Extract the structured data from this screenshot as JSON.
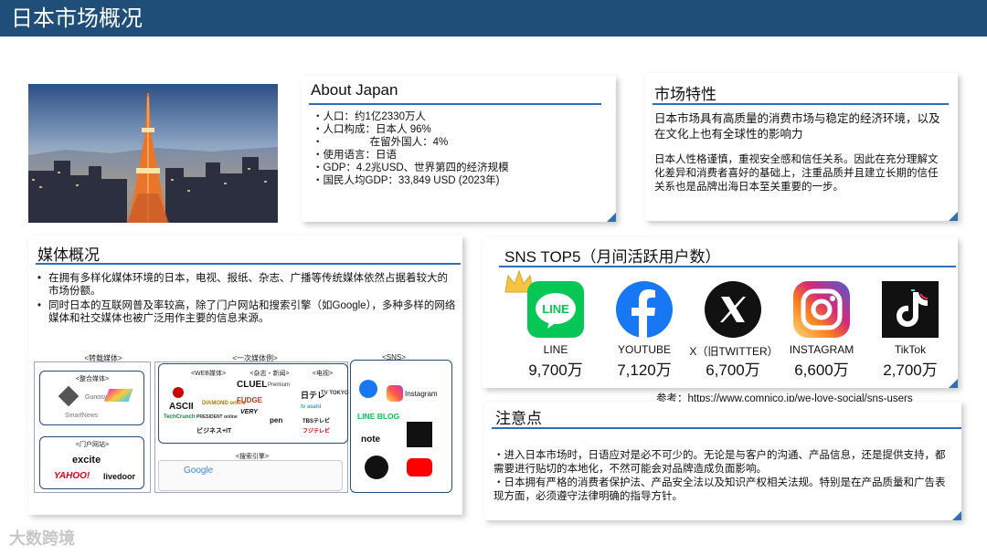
{
  "header": {
    "title": "日本市场概况"
  },
  "about": {
    "title": "About Japan",
    "items": [
      "人口：约1亿2330万人",
      "人口构成：日本人  96%",
      "                在留外国人：4%",
      "使用语言：日语",
      "GDP：4.2兆USD、世界第四的经济规模",
      "国民人均GDP：33,849 USD (2023年)"
    ]
  },
  "market": {
    "title": "市场特性",
    "p1": "日本市场具有高质量的消费市场与稳定的经济环境，以及在文化上也有全球性的影响力",
    "p2": "日本人性格谨慎，重视安全感和信任关系。因此在充分理解文化差异和消费者喜好的基础上，注重品质并且建立长期的信任关系也是品牌出海日本至关重要的一步。"
  },
  "media": {
    "title": "媒体概况",
    "bullets": [
      "在拥有多样化媒体环境的日本，电视、报纸、杂志、广播等传统媒体依然占据着较大的市场份额。",
      "同时日本的互联网普及率较高，除了门户网站和搜索引擎（如Google），多种多样的网络媒体和社交媒体也被广泛用作主要的信息来源。"
    ],
    "diagram": {
      "reprint": "<转载媒体>",
      "aggregate": "<整合媒体>",
      "portal": "<门户网站>",
      "primary": "<一次媒体例>",
      "web": "<WEB媒体>",
      "magazine": "<杂志・新闻>",
      "tv": "<电视>",
      "search": "<搜索引擎>",
      "sns": "<SNS>",
      "brands": {
        "gunosy": "Gunosy",
        "smartnews": "SmartNews",
        "excite": "excite",
        "yahoo": "YAHOO!",
        "livedoor": "livedoor",
        "clue": "CLUEL",
        "premium": "Premium",
        "ascii": "ASCII",
        "diamond": "DIAMOND online",
        "fudge": "FUDGE",
        "techcrunch": "TechCrunch",
        "president": "PRESIDENT online",
        "very": "VERY",
        "pen": "pen",
        "bizit": "ビジネス+IT",
        "ntv": "日テレ",
        "tvtokyo": "TV TOKYO",
        "tbs": "TBSテレビ",
        "fuji": "フジテレビ",
        "tvasahi": "tv asahi",
        "google": "Google",
        "instagram": "Instagram",
        "lineblog": "LINE BLOG",
        "note": "note"
      }
    }
  },
  "sns": {
    "title": "SNS TOP5（月间活跃用户数）",
    "items": [
      {
        "name": "LINE",
        "value": "9,700万"
      },
      {
        "name": "YOUTUBE",
        "value": "7,120万"
      },
      {
        "name": "X（旧TWITTER）",
        "value": "6,700万"
      },
      {
        "name": "INSTAGRAM",
        "value": "6,600万"
      },
      {
        "name": "TikTok",
        "value": "2,700万"
      }
    ],
    "ref_prefix": "参考：https://",
    "ref_link": "www.comnico.jp/we-love-social/sns-users"
  },
  "notes": {
    "title": "注意点",
    "lines": [
      "・进入日本市场时，日语应对是必不可少的。无论是与客户的沟通、产品信息，还是提供支持，都需要进行贴切的本地化，不然可能会对品牌造成负面影响。",
      "・日本拥有严格的消费者保护法、产品安全法以及知识产权相关法规。特别是在产品质量和广告表现方面，必须遵守法律明确的指导方针。"
    ]
  },
  "watermark": "大数跨境",
  "colors": {
    "header": "#1f4e79",
    "accent": "#2f6fb5"
  }
}
